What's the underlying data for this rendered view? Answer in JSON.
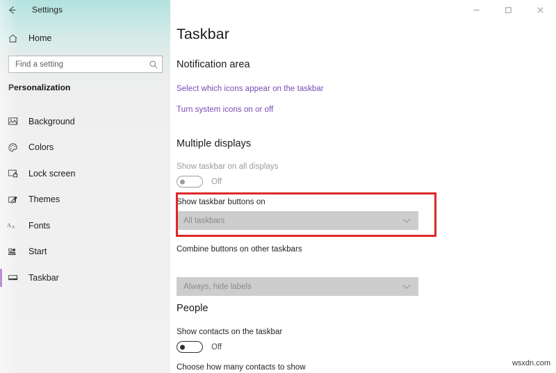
{
  "window": {
    "app_title": "Settings",
    "back_icon": "back-arrow-icon",
    "controls": {
      "minimize": "minimize-icon",
      "maximize": "maximize-icon",
      "close": "close-icon"
    }
  },
  "sidebar": {
    "home_label": "Home",
    "home_icon": "home-icon",
    "search": {
      "placeholder": "Find a setting",
      "value": "",
      "icon": "search-icon"
    },
    "category": "Personalization",
    "accent_color": "#8a3ab0",
    "items": [
      {
        "label": "Background",
        "icon": "picture-icon",
        "selected": false
      },
      {
        "label": "Colors",
        "icon": "palette-icon",
        "selected": false
      },
      {
        "label": "Lock screen",
        "icon": "lock-screen-icon",
        "selected": false
      },
      {
        "label": "Themes",
        "icon": "brush-icon",
        "selected": false
      },
      {
        "label": "Fonts",
        "icon": "font-aa-icon",
        "selected": false
      },
      {
        "label": "Start",
        "icon": "start-tiles-icon",
        "selected": false
      },
      {
        "label": "Taskbar",
        "icon": "taskbar-icon",
        "selected": true
      }
    ]
  },
  "main": {
    "page_title": "Taskbar",
    "sections": {
      "notification_area": {
        "heading": "Notification area",
        "links": [
          "Select which icons appear on the taskbar",
          "Turn system icons on or off"
        ]
      },
      "multiple_displays": {
        "heading": "Multiple displays",
        "show_taskbar_all_displays": {
          "label": "Show taskbar on all displays",
          "state": "Off",
          "enabled": false
        },
        "show_taskbar_buttons_on": {
          "label": "Show taskbar buttons on",
          "value": "All taskbars",
          "chevron": "chevron-down-icon",
          "highlighted": true
        },
        "combine_buttons": {
          "label": "Combine buttons on other taskbars",
          "value": "Always, hide labels",
          "chevron": "chevron-down-icon"
        }
      },
      "people": {
        "heading": "People",
        "show_contacts": {
          "label": "Show contacts on the taskbar",
          "state": "Off",
          "enabled": true
        },
        "choose_contacts_label": "Choose how many contacts to show"
      }
    },
    "highlight_color": "#e02626"
  },
  "watermark": "wsxdn.com"
}
